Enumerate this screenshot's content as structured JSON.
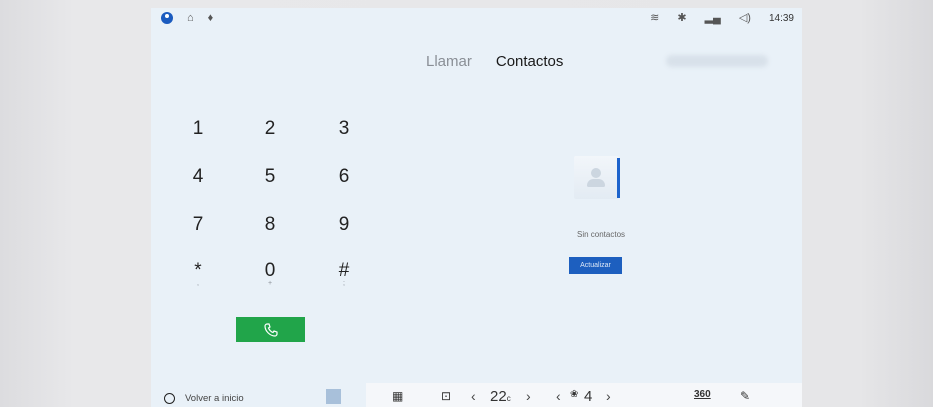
{
  "status_bar": {
    "left_icons": [
      "profile-icon",
      "notification-icon",
      "microphone-icon"
    ],
    "right_icons": [
      "wifi-icon",
      "bluetooth-icon",
      "signal-icon",
      "volume-icon"
    ],
    "time": "14:39"
  },
  "tabs": [
    {
      "label": "Llamar",
      "active": false
    },
    {
      "label": "Contactos",
      "active": true
    }
  ],
  "keypad": {
    "keys": [
      {
        "main": "1",
        "sub": ""
      },
      {
        "main": "2",
        "sub": ""
      },
      {
        "main": "3",
        "sub": ""
      },
      {
        "main": "4",
        "sub": ""
      },
      {
        "main": "5",
        "sub": ""
      },
      {
        "main": "6",
        "sub": ""
      },
      {
        "main": "7",
        "sub": ""
      },
      {
        "main": "8",
        "sub": ""
      },
      {
        "main": "9",
        "sub": ""
      },
      {
        "main": "*",
        "sub": ","
      },
      {
        "main": "0",
        "sub": "+"
      },
      {
        "main": "#",
        "sub": ";"
      }
    ],
    "call_icon": "phone-call-icon"
  },
  "contacts": {
    "empty_text": "Sin contactos",
    "refresh_label": "Actualizar"
  },
  "bottom_bar": {
    "home_label": "Volver a inicio",
    "temperature": "22",
    "temperature_unit": "c",
    "fan_level": "4",
    "icon_360": "360",
    "colors": {
      "accent": "#1d5fbf",
      "call": "#21a54a"
    }
  }
}
